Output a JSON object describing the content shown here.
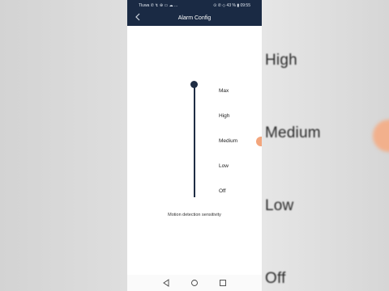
{
  "status": {
    "left": "Tluwa ✆ ↯ ⊕ ▭ ☁ ...",
    "right": "⊙ ✆ ◇ 43 % ▮ 09:55"
  },
  "header": {
    "title": "Alarm Config"
  },
  "slider": {
    "levels": [
      "Max",
      "High",
      "Medium",
      "Low",
      "Off"
    ],
    "selected": "Max",
    "label": "Motion detection sensitivity"
  },
  "background": {
    "labels": [
      "High",
      "Medium",
      "Low",
      "Off"
    ]
  },
  "colors": {
    "bar": "#1a2a44",
    "slider": "#1f2d44",
    "accent": "#f3a57c"
  },
  "icons": {
    "back": "chevron-left-icon",
    "nav_back": "triangle-back-icon",
    "nav_home": "circle-home-icon",
    "nav_recent": "square-recent-icon"
  }
}
